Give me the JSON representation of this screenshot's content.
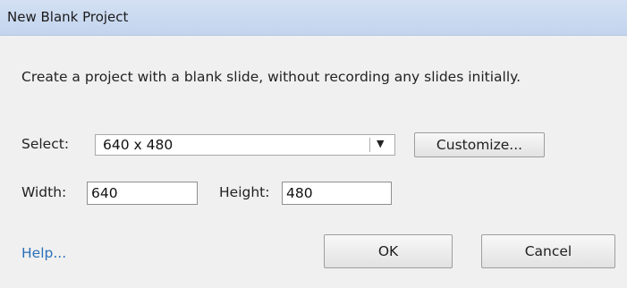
{
  "window": {
    "title": "New Blank Project"
  },
  "description": "Create a project with a blank slide, without recording any slides initially.",
  "select": {
    "label": "Select:",
    "value": "640 x 480"
  },
  "buttons": {
    "customize": "Customize...",
    "ok": "OK",
    "cancel": "Cancel"
  },
  "dimensions": {
    "width_label": "Width:",
    "width_value": "640",
    "height_label": "Height:",
    "height_value": "480"
  },
  "help": "Help...",
  "icons": {
    "dropdown": "dropdown-arrow-icon"
  },
  "colors": {
    "titlebar": "#cddbf0",
    "link": "#2b6fb8",
    "background": "#f0f0f0"
  }
}
